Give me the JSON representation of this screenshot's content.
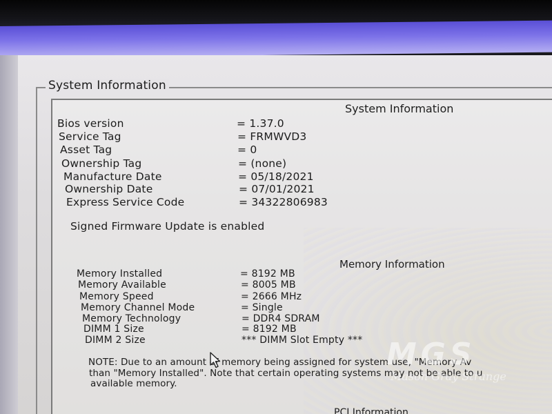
{
  "group_title": "System Information",
  "system_section": {
    "heading": "System Information",
    "rows": [
      {
        "label": "Bios version",
        "value": "= 1.37.0"
      },
      {
        "label": "Service Tag",
        "value": "= FRMWVD3"
      },
      {
        "label": "Asset Tag",
        "value": "= 0"
      },
      {
        "label": "Ownership Tag",
        "value": "= (none)"
      },
      {
        "label": "Manufacture Date",
        "value": "= 05/18/2021"
      },
      {
        "label": "Ownership Date",
        "value": "= 07/01/2021"
      },
      {
        "label": "Express Service Code",
        "value": "= 34322806983"
      }
    ],
    "message": "Signed Firmware Update is enabled"
  },
  "memory_section": {
    "heading": "Memory Information",
    "rows": [
      {
        "label": "Memory Installed",
        "value": "= 8192 MB"
      },
      {
        "label": "Memory Available",
        "value": "= 8005 MB"
      },
      {
        "label": "Memory Speed",
        "value": "= 2666 MHz"
      },
      {
        "label": "Memory Channel Mode",
        "value": "= Single"
      },
      {
        "label": "Memory Technology",
        "value": "= DDR4 SDRAM"
      },
      {
        "label": "DIMM 1 Size",
        "value": "= 8192 MB"
      },
      {
        "label": "DIMM 2 Size",
        "value": "*** DIMM Slot Empty ***"
      }
    ],
    "note_lines": [
      "NOTE: Due to an amount of memory being assigned for system use, \"Memory Av",
      "than \"Memory Installed\". Note that certain operating systems may not be able to u",
      "available memory."
    ]
  },
  "pci_section": {
    "heading": "PCI Information"
  },
  "watermark": {
    "logo": "MGS",
    "subtitle": "Mason Gray Strange"
  },
  "icons": {
    "cursor": "mouse-pointer-icon"
  }
}
